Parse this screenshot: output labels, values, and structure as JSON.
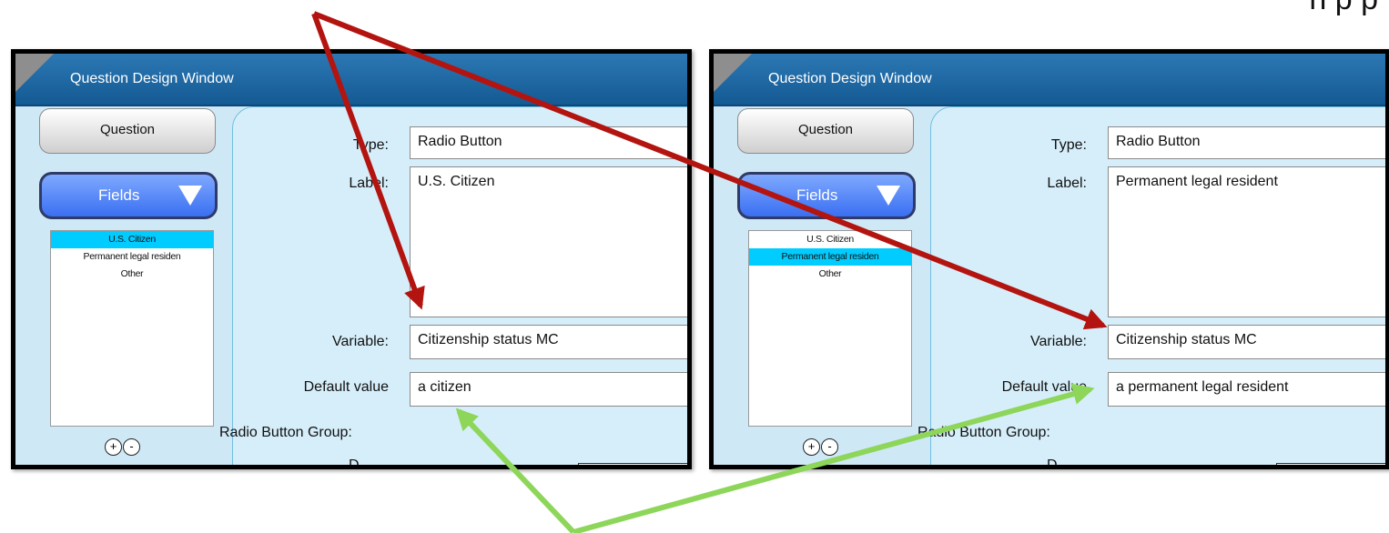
{
  "top_text": "n                                                                  p                            p",
  "panels": [
    {
      "title": "Question Design Window",
      "question_button": "Question",
      "fields_button": "Fields",
      "fields_list": [
        {
          "label": "U.S. Citizen",
          "selected": true
        },
        {
          "label": "Permanent legal residen",
          "selected": false
        },
        {
          "label": "Other",
          "selected": false
        }
      ],
      "add_icon": "+",
      "remove_icon": "-",
      "type_label": "Type:",
      "type_value": "Radio Button",
      "label_label": "Label:",
      "label_value": "U.S. Citizen",
      "variable_label": "Variable:",
      "variable_value": "Citizenship status MC",
      "default_label": "Default value",
      "default_value": "a citizen",
      "radio_group_label": "Radio Button Group:",
      "cut_off_label": "D"
    },
    {
      "title": "Question Design Window",
      "question_button": "Question",
      "fields_button": "Fields",
      "fields_list": [
        {
          "label": "U.S. Citizen",
          "selected": false
        },
        {
          "label": "Permanent legal residen",
          "selected": true
        },
        {
          "label": "Other",
          "selected": false
        }
      ],
      "add_icon": "+",
      "remove_icon": "-",
      "type_label": "Type:",
      "type_value": "Radio Button",
      "label_label": "Label:",
      "label_value": "Permanent legal resident",
      "variable_label": "Variable:",
      "variable_value": "Citizenship status MC",
      "default_label": "Default value",
      "default_value": "a permanent legal resident",
      "radio_group_label": "Radio Button Group:",
      "cut_off_label": "D"
    }
  ],
  "arrow_colors": {
    "red": "#b3140f",
    "green": "#8dd65a"
  }
}
